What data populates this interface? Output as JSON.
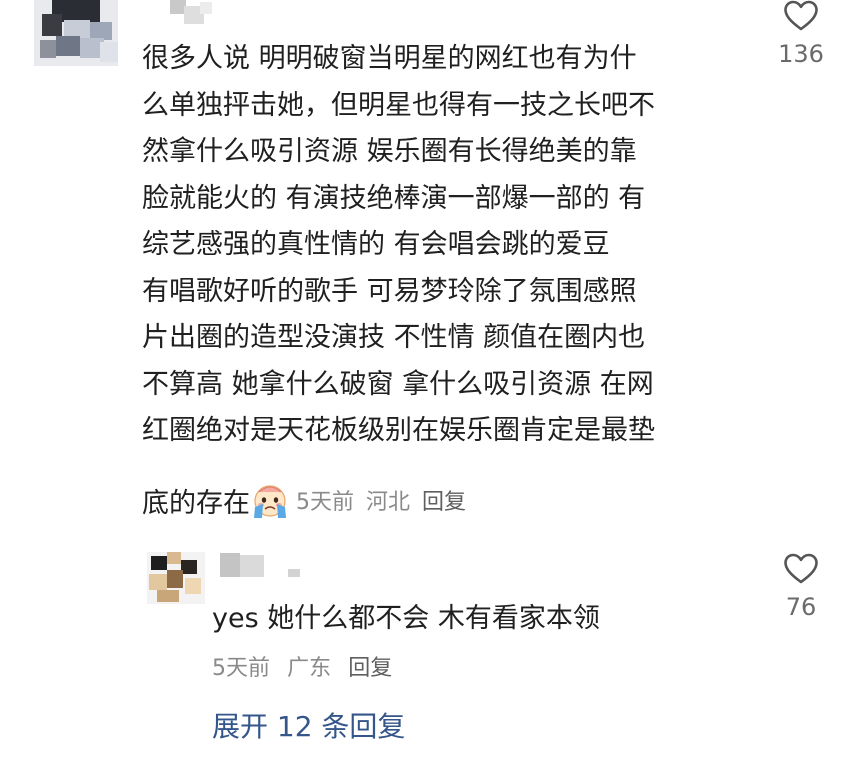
{
  "main_comment": {
    "text_lines": [
      "很多人说 明明破窗当明星的网红也有为什",
      "么单独抨击她，但明星也得有一技之长吧不",
      "然拿什么吸引资源  娱乐圈有长得绝美的靠",
      "脸就能火的 有演技绝棒演一部爆一部的  有",
      "综艺感强的真性情的  有会唱会跳的爱豆",
      "有唱歌好听的歌手  可易梦玲除了氛围感照",
      "片出圈的造型没演技 不性情  颜值在圈内也",
      "不算高 她拿什么破窗 拿什么吸引资源 在网",
      "红圈绝对是天花板级别在娱乐圈肯定是最垫"
    ],
    "last_line": "底的存在",
    "emoji": "crying-face-emoji",
    "time": "5天前",
    "location": "河北",
    "reply_label": "回复",
    "like_count": "136",
    "like_icon": "heart-outline-icon"
  },
  "reply": {
    "text": "yes 她什么都不会 木有看家本领",
    "time": "5天前",
    "location": "广东",
    "reply_label": "回复",
    "like_count": "76",
    "like_icon": "heart-outline-icon"
  },
  "expand": {
    "label": "展开 12 条回复"
  },
  "colors": {
    "text": "#202020",
    "meta": "#8a8a8a",
    "link": "#34568b",
    "icon": "#555555"
  }
}
